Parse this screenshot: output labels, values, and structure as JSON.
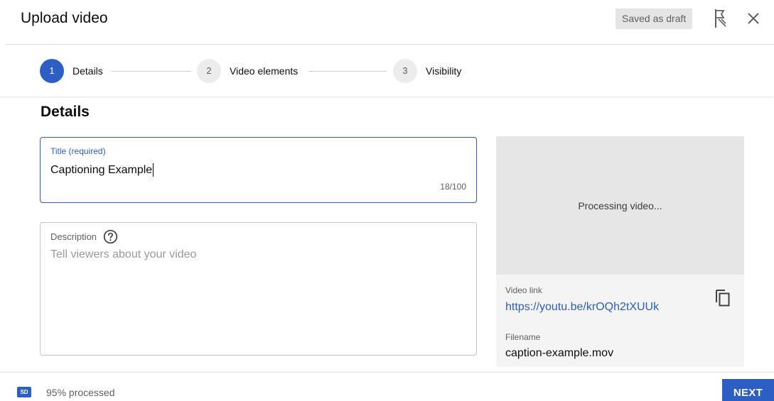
{
  "header": {
    "title": "Upload video",
    "draft_status": "Saved as draft",
    "icons": {
      "feedback": "feedback-flag-icon",
      "close": "close-icon"
    }
  },
  "stepper": {
    "steps": [
      {
        "number": "1",
        "label": "Details",
        "state": "active"
      },
      {
        "number": "2",
        "label": "Video elements",
        "state": "inactive"
      },
      {
        "number": "3",
        "label": "Visibility",
        "state": "inactive"
      }
    ]
  },
  "details": {
    "section_title": "Details",
    "title_field": {
      "label": "Title (required)",
      "value": "Captioning Example",
      "char_count": "18/100"
    },
    "description_field": {
      "label": "Description",
      "placeholder": "Tell viewers about your video",
      "help_icon": "help-circle-icon"
    }
  },
  "preview": {
    "status": "Processing video...",
    "video_link_label": "Video link",
    "video_link": "https://youtu.be/krOQh2tXUUk",
    "filename_label": "Filename",
    "filename": "caption-example.mov",
    "copy_icon": "copy-icon"
  },
  "footer": {
    "quality_badge": "SD",
    "progress_text": "95% processed",
    "next_label": "NEXT"
  },
  "colors": {
    "accent": "#2c5ec4",
    "draft_badge_bg": "#e5e5e5",
    "preview_bg": "#e6e6e6"
  }
}
